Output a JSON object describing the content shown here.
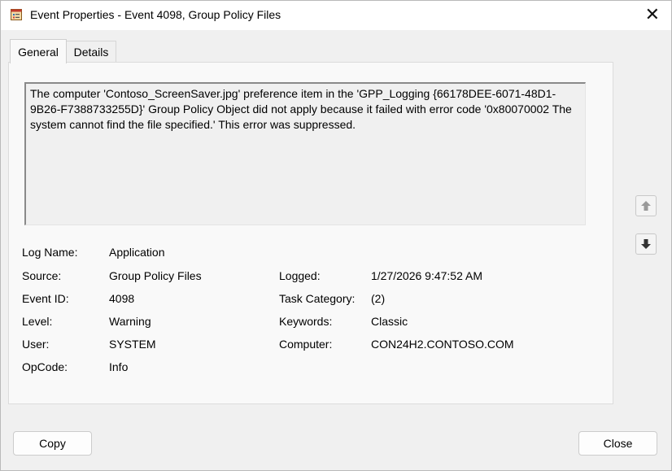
{
  "window": {
    "title": "Event Properties - Event 4098, Group Policy Files",
    "close_glyph": "✕",
    "icon": "event-log-icon"
  },
  "tabs": [
    {
      "label": "General",
      "selected": true
    },
    {
      "label": "Details",
      "selected": false
    }
  ],
  "message": "The computer 'Contoso_ScreenSaver.jpg' preference item in the 'GPP_Logging {66178DEE-6071-48D1-9B26-F7388733255D}' Group Policy Object did not apply because it failed with error code '0x80070002 The system cannot find the file specified.' This error was suppressed.",
  "fields": {
    "log_name": {
      "label": "Log Name:",
      "value": "Application"
    },
    "source": {
      "label": "Source:",
      "value": "Group Policy Files"
    },
    "event_id": {
      "label": "Event ID:",
      "value": "4098"
    },
    "level": {
      "label": "Level:",
      "value": "Warning"
    },
    "user": {
      "label": "User:",
      "value": "SYSTEM"
    },
    "opcode": {
      "label": "OpCode:",
      "value": "Info"
    },
    "logged": {
      "label": "Logged:",
      "value": "1/27/2026 9:47:52 AM"
    },
    "task_category": {
      "label": "Task Category:",
      "value": "(2)"
    },
    "keywords": {
      "label": "Keywords:",
      "value": "Classic"
    },
    "computer": {
      "label": "Computer:",
      "value": "CON24H2.CONTOSO.COM"
    }
  },
  "nav": {
    "up_icon": "arrow-up-icon",
    "down_icon": "arrow-down-icon"
  },
  "buttons": {
    "copy": "Copy",
    "close": "Close"
  },
  "colors": {
    "background": "#f0f0f0",
    "panel": "#f9f9f9",
    "title_bar": "#ffffff"
  }
}
